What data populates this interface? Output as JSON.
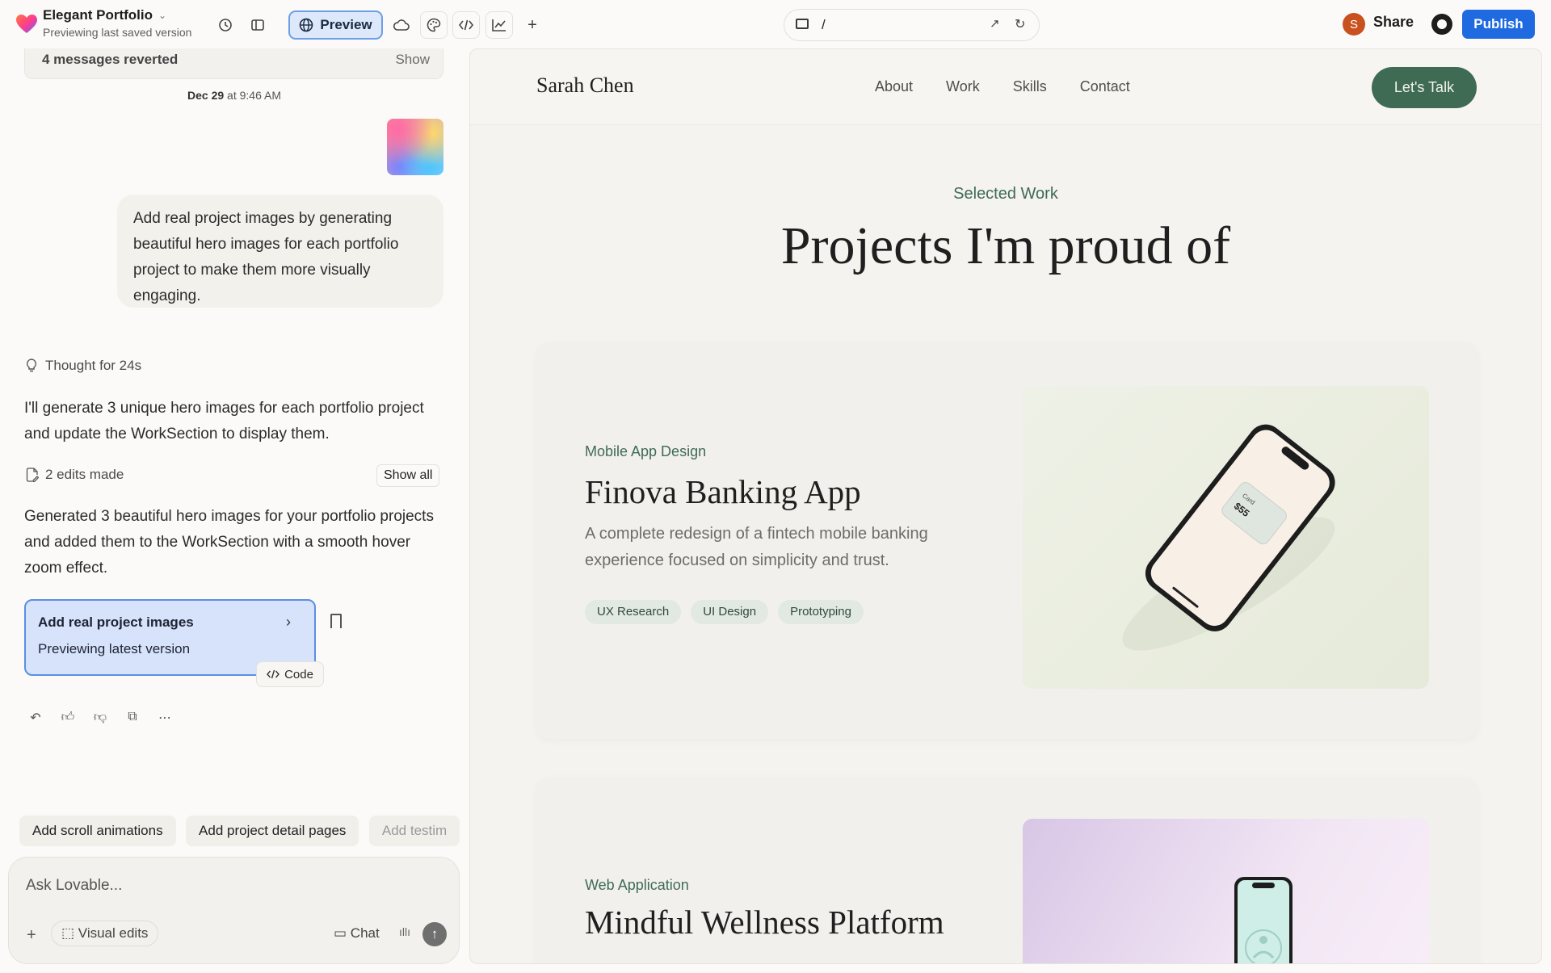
{
  "topbar": {
    "project_title": "Elegant Portfolio",
    "project_subtitle": "Previewing last saved version",
    "preview_label": "Preview",
    "url_path": "/",
    "avatar_initial": "S",
    "share_label": "Share",
    "publish_label": "Publish"
  },
  "chat": {
    "reverted_text": "4 messages reverted",
    "reverted_show": "Show",
    "date": "Dec 29",
    "time": "at 9:46 AM",
    "user_message": "Add real project images by generating beautiful hero images for each portfolio project to make them more visually engaging.",
    "thought": "Thought for 24s",
    "reply_1": "I'll generate 3 unique hero images for each portfolio project and update the WorkSection to display them.",
    "edits": "2 edits made",
    "show_all": "Show all",
    "reply_2": "Generated 3 beautiful hero images for your portfolio projects and added them to the WorkSection with a smooth hover zoom effect.",
    "version_title": "Add real project images",
    "version_sub": "Previewing latest version",
    "code_label": "Code",
    "suggestions": [
      "Add scroll animations",
      "Add project detail pages",
      "Add testim"
    ],
    "composer_placeholder": "Ask Lovable...",
    "visual_edits": "Visual edits",
    "chat_label": "Chat"
  },
  "site": {
    "brand": "Sarah Chen",
    "nav": [
      "About",
      "Work",
      "Skills",
      "Contact"
    ],
    "cta": "Let's Talk",
    "eyebrow": "Selected Work",
    "title": "Projects I'm proud of",
    "projects": [
      {
        "category": "Mobile App Design",
        "title": "Finova Banking App",
        "description": "A complete redesign of a fintech mobile banking experience focused on simplicity and trust.",
        "tags": [
          "UX Research",
          "UI Design",
          "Prototyping"
        ],
        "screen_label": "Card",
        "screen_amount": "$55"
      },
      {
        "category": "Web Application",
        "title": "Mindful Wellness Platform"
      }
    ]
  },
  "colors": {
    "accent_green": "#3f6b55",
    "publish_blue": "#1f6ae0",
    "selected_blue": "#d7e3fb"
  }
}
